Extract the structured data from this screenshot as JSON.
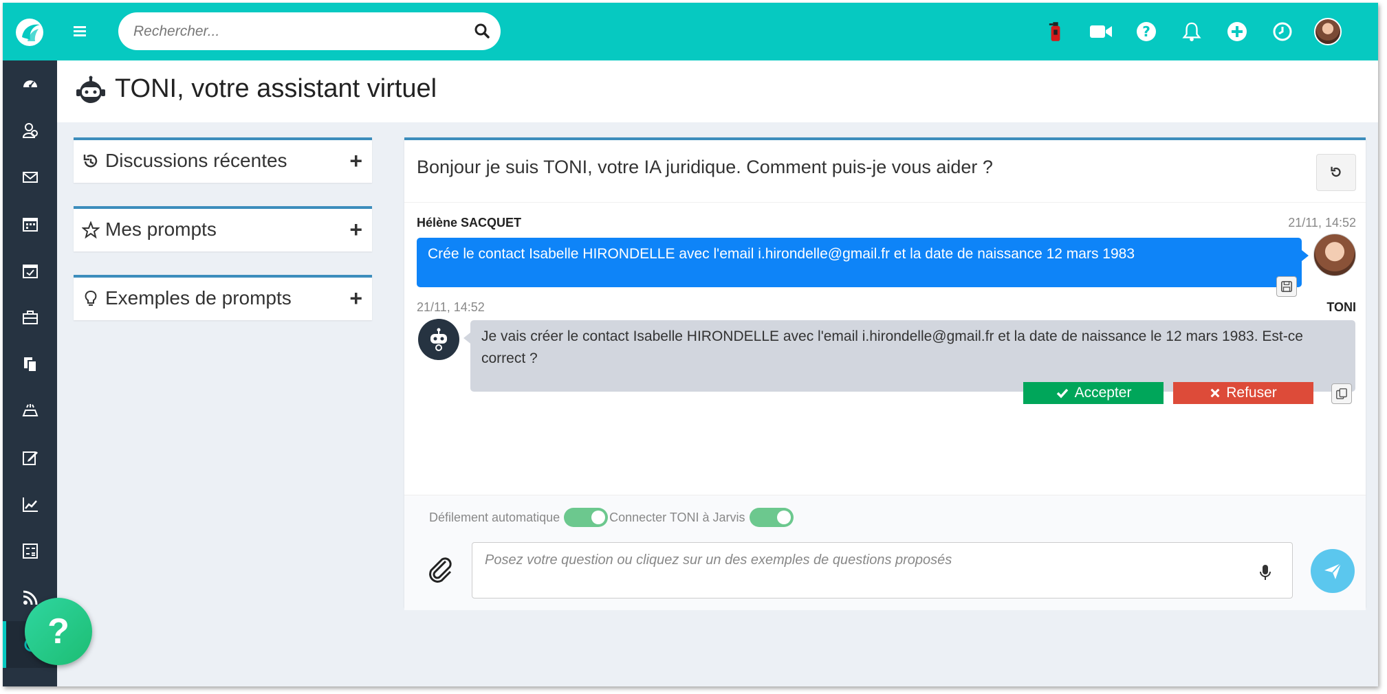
{
  "search": {
    "placeholder": "Rechercher..."
  },
  "topbar": {
    "icons": [
      "fire-extinguisher-icon",
      "video-icon",
      "help-circle-icon",
      "bell-icon",
      "plus-circle-icon",
      "clock-icon",
      "user-avatar"
    ]
  },
  "sidebar": {
    "items": [
      "dashboard-icon",
      "contacts-icon",
      "mail-icon",
      "calendar-icon",
      "calendar-check-icon",
      "briefcase-icon",
      "documents-icon",
      "timesheet-icon",
      "edit-icon",
      "chart-icon",
      "calculator-icon",
      "rss-icon",
      "toni-icon"
    ]
  },
  "page": {
    "title": "TONI, votre assistant virtuel"
  },
  "panels": {
    "recent": "Discussions récentes",
    "prompts": "Mes prompts",
    "examples": "Exemples de prompts",
    "plus": "+"
  },
  "chat": {
    "greeting": "Bonjour je suis TONI, votre IA juridique. Comment puis-je vous aider ?",
    "messages": [
      {
        "author_first": "Hélène",
        "author_last": "SACQUET",
        "time": "21/11, 14:52",
        "text": "Crée le contact Isabelle HIRONDELLE avec l'email i.hirondelle@gmail.fr et la date de naissance 12 mars 1983"
      },
      {
        "author": "TONI",
        "time": "21/11, 14:52",
        "text": "Je vais créer le contact Isabelle HIRONDELLE avec l'email i.hirondelle@gmail.fr et la date de naissance le 12 mars 1983. Est-ce correct ?"
      }
    ],
    "accept_label": "Accepter",
    "refuse_label": "Refuser",
    "toggle_autoscroll": "Défilement automatique",
    "toggle_jarvis": "Connecter TONI à Jarvis",
    "input_placeholder": "Posez votre question ou cliquez sur un des exemples de questions proposés"
  },
  "help": {
    "label": "?"
  },
  "colors": {
    "topbar": "#06c9c1",
    "sidebar": "#263341",
    "user_bubble": "#0e84f8",
    "accept": "#00a65a",
    "refuse": "#dd4b39",
    "toggle": "#6cc88e",
    "send": "#5bc7ee"
  }
}
